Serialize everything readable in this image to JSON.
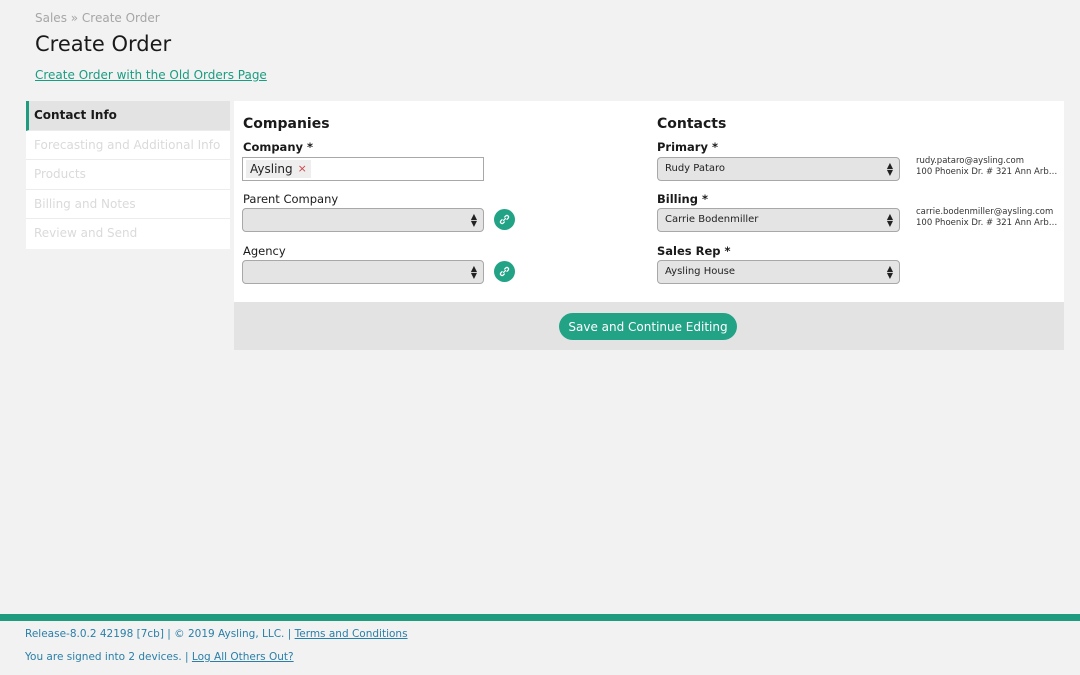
{
  "breadcrumb": "Sales » Create Order",
  "page_title": "Create Order",
  "old_orders_link": "Create Order with the Old Orders Page",
  "sidebar": {
    "items": [
      {
        "label": "Contact Info"
      },
      {
        "label": "Forecasting and Additional Info"
      },
      {
        "label": "Products"
      },
      {
        "label": "Billing and Notes"
      },
      {
        "label": "Review and Send"
      }
    ]
  },
  "companies": {
    "title": "Companies",
    "company_label": "Company *",
    "company_tag": "Aysling",
    "tag_remove": "×",
    "parent_label": "Parent Company",
    "parent_value": "",
    "agency_label": "Agency",
    "agency_value": ""
  },
  "contacts": {
    "title": "Contacts",
    "primary_label": "Primary *",
    "primary_value": "Rudy Pataro",
    "primary_email": "rudy.pataro@aysling.com",
    "primary_address": "100 Phoenix Dr. # 321 Ann Arbo...",
    "billing_label": "Billing *",
    "billing_value": "Carrie Bodenmiller",
    "billing_email": "carrie.bodenmiller@aysling.com",
    "billing_address": "100 Phoenix Dr. # 321 Ann Arbo...",
    "salesrep_label": "Sales Rep *",
    "salesrep_value": "Aysling House"
  },
  "actions": {
    "save_label": "Save and Continue Editing"
  },
  "footer": {
    "release": "Release-8.0.2 42198 [7cb] | © 2019 Aysling, LLC. |",
    "terms": "Terms and Conditions",
    "signed_in": "You are signed into 2 devices. |",
    "logout": "Log All Others Out?"
  },
  "icons": {
    "select_arrow": "up-down-chevron-icon",
    "link": "link-icon"
  },
  "colors": {
    "accent": "#22a386",
    "link": "#1a9c82",
    "footer_link": "#2a7fa8"
  }
}
